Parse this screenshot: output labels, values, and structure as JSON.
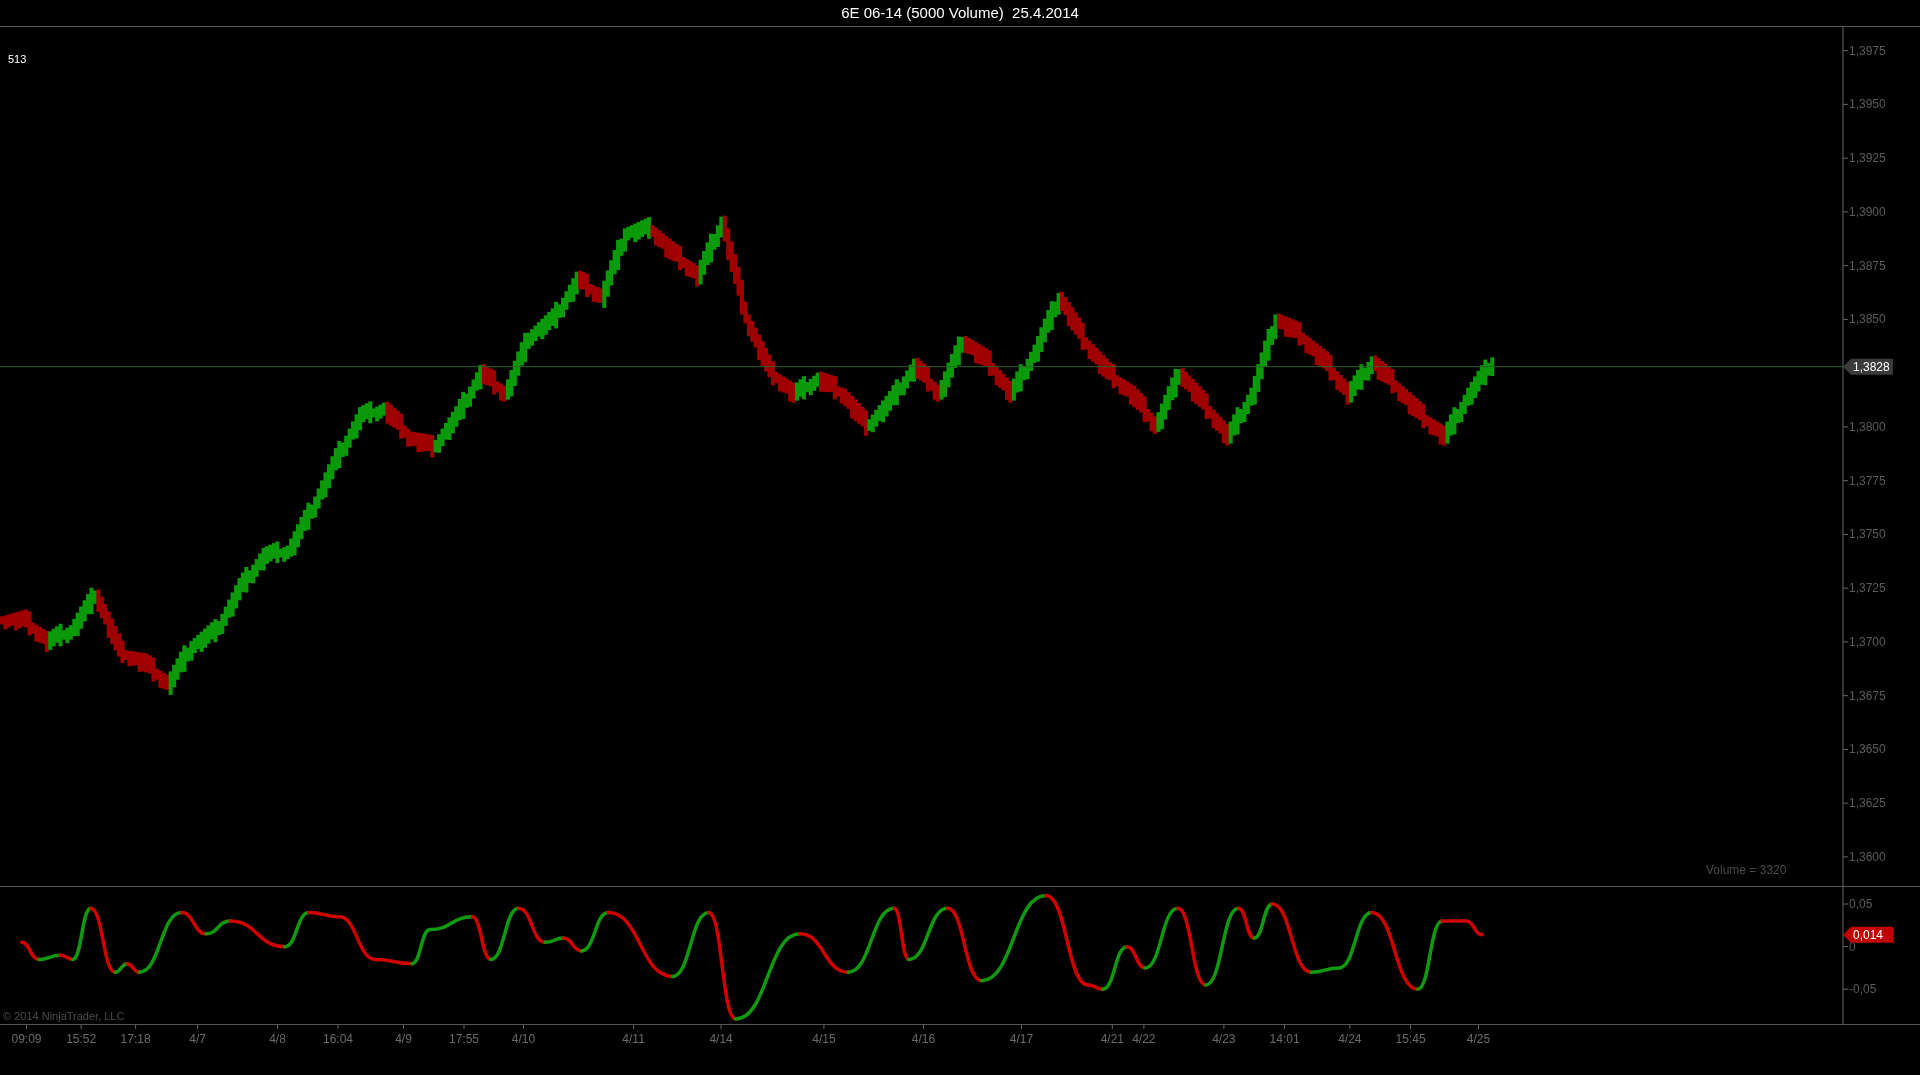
{
  "window": {
    "title": "6E 06-14 (5000 Volume)  25.4.2014"
  },
  "price_panel": {
    "bar_count": "513",
    "volume_label": "Volume = 3320",
    "axis_labels": [
      "1,3975",
      "1,3950",
      "1,3925",
      "1,3900",
      "1,3875",
      "1,3850",
      "1,3800",
      "1,3775",
      "1,3750",
      "1,3725",
      "1,3700",
      "1,3675",
      "1,3650",
      "1,3625",
      "1,3600"
    ],
    "last_price": "1,3828"
  },
  "oscillator_panel": {
    "copyright": "© 2014 NinjaTrader, LLC",
    "axis_labels": [
      "0,05",
      "0",
      "-0,05"
    ],
    "last_value": "0,014"
  },
  "time_axis": {
    "labels": [
      "09:09",
      "15:52",
      "17:18",
      "4/7",
      "4/8",
      "16:04",
      "4/9",
      "17:55",
      "4/10",
      "4/11",
      "4/14",
      "4/15",
      "4/16",
      "4/17",
      "4/21",
      "4/22",
      "4/23",
      "14:01",
      "4/24",
      "15:45",
      "4/25"
    ]
  }
}
